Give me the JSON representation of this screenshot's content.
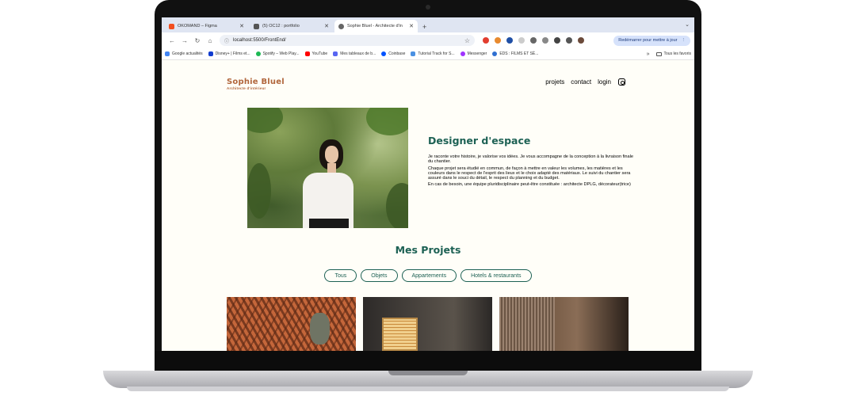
{
  "browser": {
    "tabs": [
      {
        "title": "OKOMAND – Figma",
        "favicon_color": "#f24e1e"
      },
      {
        "title": "(5) OC12 : portfolio",
        "favicon_color": "#555555"
      },
      {
        "title": "Sophie Bluel - Architecte d'in",
        "favicon_color": "#666666"
      }
    ],
    "new_tab": "+",
    "close": "✕",
    "url": "localhost:5500/FrontEnd/",
    "relaunch_label": "Redémarrer pour mettre à jour",
    "bookmarks": [
      {
        "label": "Google actualités",
        "color": "#4285f4"
      },
      {
        "label": "Disney+ | Films et...",
        "color": "#113ccf"
      },
      {
        "label": "Spotify – Web Play...",
        "color": "#1db954"
      },
      {
        "label": "YouTube",
        "color": "#ff0000"
      },
      {
        "label": "Mes tableaux de b...",
        "color": "#5865f2"
      },
      {
        "label": "Coinbase",
        "color": "#0052ff"
      },
      {
        "label": "Tutorial Track for S...",
        "color": "#4a90e2"
      },
      {
        "label": "Messenger",
        "color": "#a033ff"
      },
      {
        "label": "EDS : FILMS ET SÉ...",
        "color": "#2f6fd1"
      }
    ],
    "bookmarks_more": "»",
    "bookmarks_folder": "Tous les favoris"
  },
  "site": {
    "logo": "Sophie Bluel",
    "logo_sub": "Architecte d'intérieur",
    "nav": [
      "projets",
      "contact",
      "login"
    ],
    "intro_title": "Designer d'espace",
    "intro_paragraphs": [
      "Je raconte votre histoire, je valorise vos idées. Je vous accompagne de la conception à la livraison finale du chantier.",
      "Chaque projet sera étudié en commun, de façon à mettre en valeur les volumes, les matières et les couleurs dans le respect de l'esprit des lieux et le choix adapté des matériaux. Le suivi du chantier sera assuré dans le souci du détail, le respect du planning et du budget.",
      "En cas de besoin, une équipe pluridisciplinaire peut-être constituée : architecte DPLG, décorateur(trice)"
    ],
    "projects_title": "Mes Projets",
    "filters": [
      "Tous",
      "Objets",
      "Appartements",
      "Hotels & restaurants"
    ],
    "accent_color": "#1d6154",
    "brand_color": "#b1663c"
  }
}
